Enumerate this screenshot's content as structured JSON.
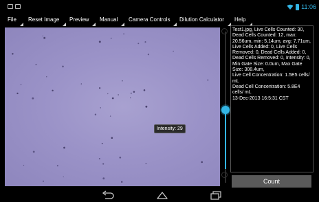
{
  "status_bar": {
    "time": "11:06",
    "icons": [
      "picture-notification-icon",
      "screenshot-notification-icon",
      "wifi-icon",
      "battery-icon"
    ],
    "accent_color": "#33b5e5"
  },
  "menu": {
    "items": [
      "File",
      "Reset Image",
      "Preview",
      "Manual",
      "Camera Controls",
      "Dilution Calculator",
      "Help"
    ]
  },
  "image_view": {
    "tooltip": "Intensity: 29",
    "background_color": "#9b93c8"
  },
  "slider": {
    "value": 0.44
  },
  "info_panel": {
    "text": "Test1.jpg, Live Cells Counted: 30, Dead Cells Counted: 12, max: 20.56um, min: 5.14um, avg: 7.71um, Live Cells Added: 0, Live Cells Removed: 0, Dead Cells Added: 0, Dead Cells Removed: 0, Intensity: 0, Min Gate Size: 0.0um, Max Gate Size: 308.4um,\nLive Cell Concentration: 1.5E5 cells/ mL\nDead Cell Concentration: 5.8E4 cells/ mL\n13-Dec-2013 16:5:31 CST"
  },
  "count_button": {
    "label": "Count"
  },
  "nav_bar": {
    "icons": [
      "back-icon",
      "home-icon",
      "recent-apps-icon"
    ]
  }
}
